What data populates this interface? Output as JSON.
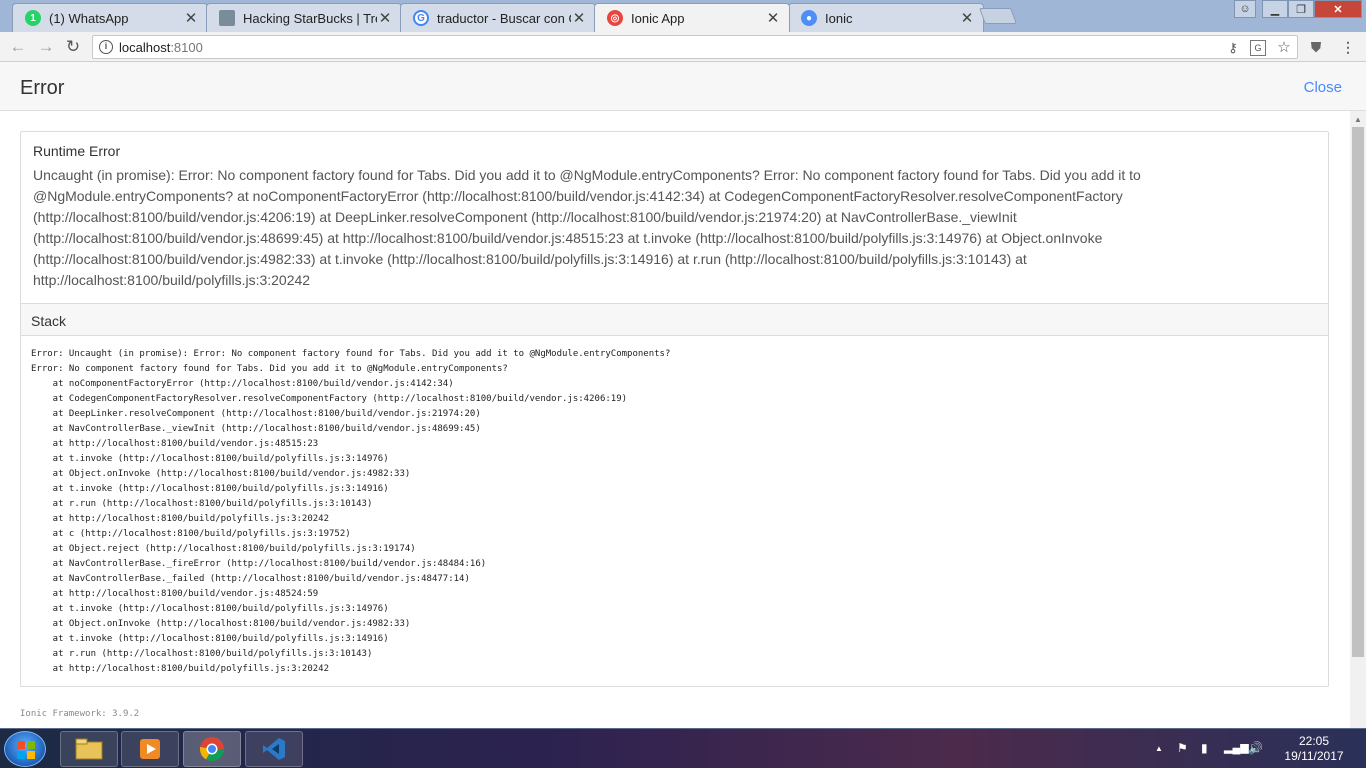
{
  "browser": {
    "tabs": [
      {
        "title": "(1) WhatsApp",
        "favicon": "whatsapp-icon",
        "color": "#25d366"
      },
      {
        "title": "Hacking StarBucks | Tree",
        "favicon": "treehouse-icon",
        "color": "#7a8b99"
      },
      {
        "title": "traductor - Buscar con G",
        "favicon": "google-icon",
        "color": "#4285f4"
      },
      {
        "title": "Ionic App",
        "favicon": "ionic-icon",
        "color": "#e8453c"
      },
      {
        "title": "Ionic",
        "favicon": "ionic-docs-icon",
        "color": "#4e8ef7"
      }
    ],
    "tab_close_glyph": "✕",
    "address": {
      "host": "localhost",
      "port": ":8100"
    }
  },
  "page": {
    "title": "Error",
    "close_label": "Close",
    "runtime_error_title": "Runtime Error",
    "runtime_error_message": "Uncaught (in promise): Error: No component factory found for Tabs. Did you add it to @NgModule.entryComponents? Error: No component factory found for Tabs. Did you add it to @NgModule.entryComponents? at noComponentFactoryError (http://localhost:8100/build/vendor.js:4142:34) at CodegenComponentFactoryResolver.resolveComponentFactory (http://localhost:8100/build/vendor.js:4206:19) at DeepLinker.resolveComponent (http://localhost:8100/build/vendor.js:21974:20) at NavControllerBase._viewInit (http://localhost:8100/build/vendor.js:48699:45) at http://localhost:8100/build/vendor.js:48515:23 at t.invoke (http://localhost:8100/build/polyfills.js:3:14976) at Object.onInvoke (http://localhost:8100/build/vendor.js:4982:33) at t.invoke (http://localhost:8100/build/polyfills.js:3:14916) at r.run (http://localhost:8100/build/polyfills.js:3:10143) at http://localhost:8100/build/polyfills.js:3:20242",
    "stack_title": "Stack",
    "stack_lines": [
      "Error: Uncaught (in promise): Error: No component factory found for Tabs. Did you add it to @NgModule.entryComponents?",
      "Error: No component factory found for Tabs. Did you add it to @NgModule.entryComponents?",
      "    at noComponentFactoryError (http://localhost:8100/build/vendor.js:4142:34)",
      "    at CodegenComponentFactoryResolver.resolveComponentFactory (http://localhost:8100/build/vendor.js:4206:19)",
      "    at DeepLinker.resolveComponent (http://localhost:8100/build/vendor.js:21974:20)",
      "    at NavControllerBase._viewInit (http://localhost:8100/build/vendor.js:48699:45)",
      "    at http://localhost:8100/build/vendor.js:48515:23",
      "    at t.invoke (http://localhost:8100/build/polyfills.js:3:14976)",
      "    at Object.onInvoke (http://localhost:8100/build/vendor.js:4982:33)",
      "    at t.invoke (http://localhost:8100/build/polyfills.js:3:14916)",
      "    at r.run (http://localhost:8100/build/polyfills.js:3:10143)",
      "    at http://localhost:8100/build/polyfills.js:3:20242",
      "    at c (http://localhost:8100/build/polyfills.js:3:19752)",
      "    at Object.reject (http://localhost:8100/build/polyfills.js:3:19174)",
      "    at NavControllerBase._fireError (http://localhost:8100/build/vendor.js:48484:16)",
      "    at NavControllerBase._failed (http://localhost:8100/build/vendor.js:48477:14)",
      "    at http://localhost:8100/build/vendor.js:48524:59",
      "    at t.invoke (http://localhost:8100/build/polyfills.js:3:14976)",
      "    at Object.onInvoke (http://localhost:8100/build/vendor.js:4982:33)",
      "    at t.invoke (http://localhost:8100/build/polyfills.js:3:14916)",
      "    at r.run (http://localhost:8100/build/polyfills.js:3:10143)",
      "    at http://localhost:8100/build/polyfills.js:3:20242"
    ],
    "framework_line": "Ionic Framework: 3.9.2"
  },
  "taskbar": {
    "apps": [
      "file-explorer-icon",
      "media-player-icon",
      "chrome-icon",
      "vscode-icon"
    ],
    "clock_time": "22:05",
    "clock_date": "19/11/2017"
  },
  "colors": {
    "ionic_primary": "#488aff",
    "header_bg": "#f7f7f7"
  }
}
